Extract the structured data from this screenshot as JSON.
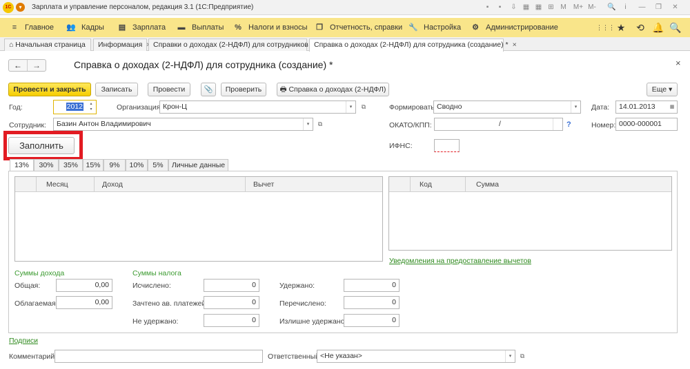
{
  "titlebar": {
    "title": "Зарплата и управление персоналом, редакция 3.1 (1С:Предприятие)",
    "logo": "1С",
    "icons": [
      "save-icon",
      "print-icon",
      "export-icon",
      "calendar-icon",
      "calculator-icon",
      "compare-icon",
      "memory-m-icon",
      "memory-plus-icon",
      "memory-minus-icon",
      "search-icon",
      "info-icon",
      "minimize-icon",
      "restore-icon",
      "close-icon"
    ],
    "glyphs": [
      "▪",
      "▪",
      "⇩",
      "▦",
      "▦",
      "⊞",
      "M",
      "M+",
      "M-",
      "🔍",
      "i",
      "—",
      "❐",
      "✕"
    ]
  },
  "mainmenu": {
    "items": [
      {
        "label": "Главное",
        "icon": "≡"
      },
      {
        "label": "Кадры",
        "icon": "👥"
      },
      {
        "label": "Зарплата",
        "icon": "▤"
      },
      {
        "label": "Выплаты",
        "icon": "▬"
      },
      {
        "label": "Налоги и взносы",
        "icon": "%"
      },
      {
        "label": "Отчетность, справки",
        "icon": "❐"
      },
      {
        "label": "Настройка",
        "icon": "🔧"
      },
      {
        "label": "Администрирование",
        "icon": "⚙"
      }
    ],
    "right_icons": [
      "⋮⋮⋮",
      "★",
      "⟲",
      "🔔",
      "🔍"
    ]
  },
  "tabs": [
    {
      "label": "Начальная страница",
      "closable": false,
      "icon": "⌂"
    },
    {
      "label": "Информация",
      "closable": true
    },
    {
      "label": "Справки о доходах (2-НДФЛ) для сотрудников",
      "closable": true
    },
    {
      "label": "Справка о доходах (2-НДФЛ) для сотрудника (создание) *",
      "closable": true
    }
  ],
  "form": {
    "title": "Справка о доходах (2-НДФЛ) для сотрудника (создание) *",
    "nav_back": "←",
    "nav_forward": "→",
    "close": "×"
  },
  "toolbar": {
    "post_close": "Провести и закрыть",
    "save": "Записать",
    "post": "Провести",
    "attach": "📎",
    "check": "Проверить",
    "print": "Справка о доходах (2-НДФЛ)",
    "more": "Еще",
    "more_arrow": "▾"
  },
  "fields": {
    "year_label": "Год:",
    "year_value": "2012",
    "org_label": "Организация:",
    "org_value": "Крон-Ц",
    "form_label": "Формировать:",
    "form_value": "Сводно",
    "date_label": "Дата:",
    "date_value": "14.01.2013",
    "employee_label": "Сотрудник:",
    "employee_value": "Базин Антон Владимирович",
    "okato_label": "ОКАТО/КПП:",
    "okato_value": "/",
    "number_label": "Номер:",
    "number_value": "0000-000001",
    "ifns_label": "ИФНС:",
    "help": "?"
  },
  "fill_button": "Заполнить",
  "rate_tabs": [
    "13%",
    "30%",
    "35%",
    "15%",
    "9%",
    "10%",
    "5%",
    "Личные данные"
  ],
  "income_grid": {
    "columns": [
      "Месяц",
      "Доход",
      "Вычет"
    ]
  },
  "deduction_grid": {
    "columns": [
      "Код",
      "Сумма"
    ]
  },
  "deduction_link": "Уведомления на предоставление вычетов",
  "income_sums": {
    "title": "Суммы дохода",
    "total_label": "Общая:",
    "total_value": "0,00",
    "taxable_label": "Облагаемая:",
    "taxable_value": "0,00"
  },
  "tax_sums": {
    "title": "Суммы налога",
    "calculated_label": "Исчислено:",
    "calculated_value": "0",
    "offset_label": "Зачтено ав. платежей:",
    "offset_value": "0",
    "not_withheld_label": "Не удержано:",
    "not_withheld_value": "0",
    "withheld_label": "Удержано:",
    "withheld_value": "0",
    "transferred_label": "Перечислено:",
    "transferred_value": "0",
    "over_withheld_label": "Излишне удержано:",
    "over_withheld_value": "0"
  },
  "signatures_link": "Подписи",
  "comment_label": "Комментарий:",
  "comment_value": "",
  "responsible_label": "Ответственный:",
  "responsible_value": "<Не указан>",
  "colors": {
    "menu_bg": "#f9e58a",
    "primary_btn": "#f5cd00",
    "highlight": "#e21b22",
    "link": "#2f8a1e"
  }
}
